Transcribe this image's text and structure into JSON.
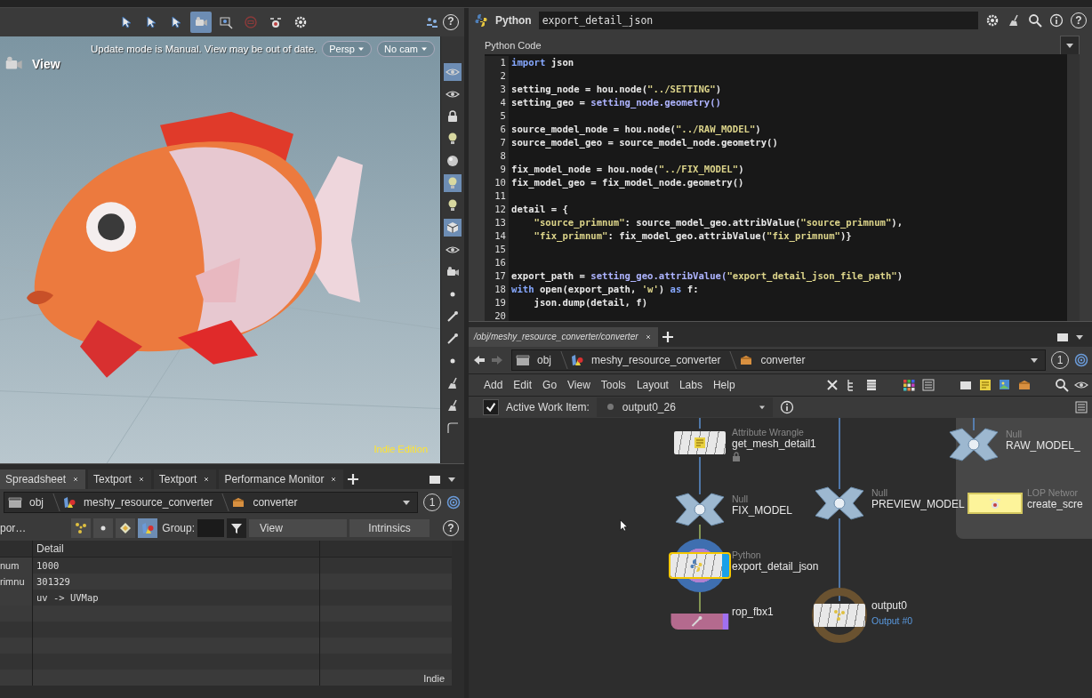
{
  "viewer_toolbar": [
    {
      "kind": "pointer",
      "selected": false
    },
    {
      "kind": "pointer",
      "selected": false
    },
    {
      "kind": "pointer",
      "selected": false
    },
    {
      "kind": "camera",
      "selected": true
    },
    {
      "kind": "zoom",
      "selected": false
    },
    {
      "kind": "stop",
      "selected": false
    },
    {
      "kind": "drone",
      "selected": false
    },
    {
      "kind": "gear",
      "selected": false
    }
  ],
  "viewer_help": "?",
  "viewport": {
    "title": "View",
    "message": "Update mode is Manual. View may be out of date.",
    "projection": "Persp",
    "camera": "No cam",
    "edition": "Indie Edition"
  },
  "viewport_tools": [
    {
      "kind": "eye",
      "selected": true
    },
    {
      "kind": "eye",
      "selected": false
    },
    {
      "kind": "lock",
      "selected": false
    },
    {
      "kind": "bulb",
      "selected": false
    },
    {
      "kind": "ball",
      "selected": false
    },
    {
      "kind": "bulb",
      "selected": true
    },
    {
      "kind": "bulb",
      "selected": false
    },
    {
      "kind": "cube",
      "selected": true
    },
    {
      "kind": "eye",
      "selected": false
    },
    {
      "kind": "camera",
      "selected": false
    },
    {
      "kind": "dot",
      "selected": false
    },
    {
      "kind": "pen",
      "selected": false
    },
    {
      "kind": "pen",
      "selected": false
    },
    {
      "kind": "dot",
      "selected": false
    },
    {
      "kind": "brush",
      "selected": false
    },
    {
      "kind": "brush",
      "selected": false
    },
    {
      "kind": "corner",
      "selected": false
    }
  ],
  "spreadsheet": {
    "tabs": [
      {
        "label": "Spreadsheet",
        "selected": true
      },
      {
        "label": "Textport",
        "selected": false
      },
      {
        "label": "Textport",
        "selected": false
      },
      {
        "label": "Performance Monitor",
        "selected": false
      }
    ],
    "path": [
      "obj",
      "meshy_resource_converter",
      "converter"
    ],
    "pin": "1",
    "source": "por…",
    "filters": [
      {
        "kind": "points",
        "selected": false
      },
      {
        "kind": "dot",
        "selected": false
      },
      {
        "kind": "diamond",
        "selected": false
      },
      {
        "kind": "shapes",
        "selected": true
      }
    ],
    "group_label": "Group:",
    "view": "View",
    "intrinsics": "Intrinsics",
    "help": "?",
    "columns": [
      "Detail"
    ],
    "rows": [
      {
        "column_1": "num",
        "detail": "1000"
      },
      {
        "column_1": "rimnu",
        "detail": "301329"
      },
      {
        "detail": "uv -> UVMap"
      }
    ],
    "badge": "Indie"
  },
  "python_panel": {
    "type": "Python",
    "name": "export_detail_json",
    "help": "?",
    "section": "Python Code",
    "lines": [
      {
        "n": "1",
        "tokens": [
          {
            "kind": "keyword",
            "text": "import"
          },
          {
            "kind": "plain",
            "text": " json"
          }
        ]
      },
      {
        "n": "2"
      },
      {
        "n": "3",
        "tokens": [
          {
            "kind": "plain",
            "text": "setting_node = hou.node("
          },
          {
            "kind": "string",
            "text": "\"../SETTING\""
          },
          {
            "kind": "plain",
            "text": ")"
          }
        ]
      },
      {
        "n": "4",
        "tokens": [
          {
            "kind": "plain",
            "text": "setting_geo = "
          },
          {
            "kind": "name",
            "text": "setting_node.geometry()"
          }
        ]
      },
      {
        "n": "5"
      },
      {
        "n": "6",
        "tokens": [
          {
            "kind": "plain",
            "text": "source_model_node = hou.node("
          },
          {
            "kind": "string",
            "text": "\"../RAW_MODEL\""
          },
          {
            "kind": "plain",
            "text": ")"
          }
        ]
      },
      {
        "n": "7",
        "tokens": [
          {
            "kind": "plain",
            "text": "source_model_geo = source_model_node.geometry()"
          }
        ]
      },
      {
        "n": "8"
      },
      {
        "n": "9",
        "tokens": [
          {
            "kind": "plain",
            "text": "fix_model_node = hou.node("
          },
          {
            "kind": "string",
            "text": "\"../FIX_MODEL\""
          },
          {
            "kind": "plain",
            "text": ")"
          }
        ]
      },
      {
        "n": "10",
        "tokens": [
          {
            "kind": "plain",
            "text": "fix_model_geo = fix_model_node.geometry()"
          }
        ]
      },
      {
        "n": "11"
      },
      {
        "n": "12",
        "tokens": [
          {
            "kind": "plain",
            "text": "detail = {"
          }
        ]
      },
      {
        "n": "13",
        "tokens": [
          {
            "kind": "string",
            "text": "    \"source_primnum\""
          },
          {
            "kind": "plain",
            "text": ": source_model_geo.attribValue("
          },
          {
            "kind": "string",
            "text": "\"source_primnum\""
          },
          {
            "kind": "plain",
            "text": "),"
          }
        ]
      },
      {
        "n": "14",
        "tokens": [
          {
            "kind": "string",
            "text": "    \"fix_primnum\""
          },
          {
            "kind": "plain",
            "text": ": fix_model_geo.attribValue("
          },
          {
            "kind": "string",
            "text": "\"fix_primnum\""
          },
          {
            "kind": "plain",
            "text": ")}"
          }
        ]
      },
      {
        "n": "15"
      },
      {
        "n": "16"
      },
      {
        "n": "17",
        "tokens": [
          {
            "kind": "plain",
            "text": "export_path = "
          },
          {
            "kind": "name",
            "text": "setting_geo.attribValue("
          },
          {
            "kind": "string",
            "text": "\"export_detail_json_file_path\""
          },
          {
            "kind": "plain",
            "text": ")"
          }
        ]
      },
      {
        "n": "18",
        "tokens": [
          {
            "kind": "keyword",
            "text": "with"
          },
          {
            "kind": "plain",
            "text": " open(export_path, "
          },
          {
            "kind": "string",
            "text": "'w'"
          },
          {
            "kind": "plain",
            "text": ") "
          },
          {
            "kind": "keyword",
            "text": "as"
          },
          {
            "kind": "plain",
            "text": " f:"
          }
        ]
      },
      {
        "n": "19",
        "tokens": [
          {
            "kind": "plain",
            "text": "    json.dump(detail, f)"
          }
        ]
      },
      {
        "n": "20"
      }
    ]
  },
  "network": {
    "tabs": [
      {
        "label": "/obj/meshy_resource_converter/converter",
        "selected": true
      }
    ],
    "path": [
      "obj",
      "meshy_resource_converter",
      "converter"
    ],
    "pin": "1",
    "menu": [
      "Add",
      "Edit",
      "Go",
      "View",
      "Tools",
      "Layout",
      "Labs",
      "Help"
    ],
    "work_item": {
      "checked": true,
      "label": "Active Work Item:",
      "value": "output0_26"
    },
    "nodes": [
      {
        "kind": "wrangle",
        "type": "Attribute Wrangle",
        "name": "get_mesh_detail1",
        "locked": true,
        "selected": false
      },
      {
        "kind": "null",
        "type": "Null",
        "name": "FIX_MODEL",
        "selected": false
      },
      {
        "kind": "python",
        "type": "Python",
        "name": "export_detail_json",
        "selected": true
      },
      {
        "kind": "rop",
        "name": "rop_fbx1",
        "selected": false
      },
      {
        "kind": "null",
        "type": "Null",
        "name": "PREVIEW_MODEL",
        "selected": false
      },
      {
        "kind": "output",
        "name": "output0",
        "output_label": "Output #0",
        "selected": false
      },
      {
        "kind": "null",
        "type": "Null",
        "name": "RAW_MODEL_",
        "selected": false
      },
      {
        "kind": "lop",
        "type": "LOP Networ",
        "name": "create_scre",
        "selected": false
      }
    ]
  }
}
